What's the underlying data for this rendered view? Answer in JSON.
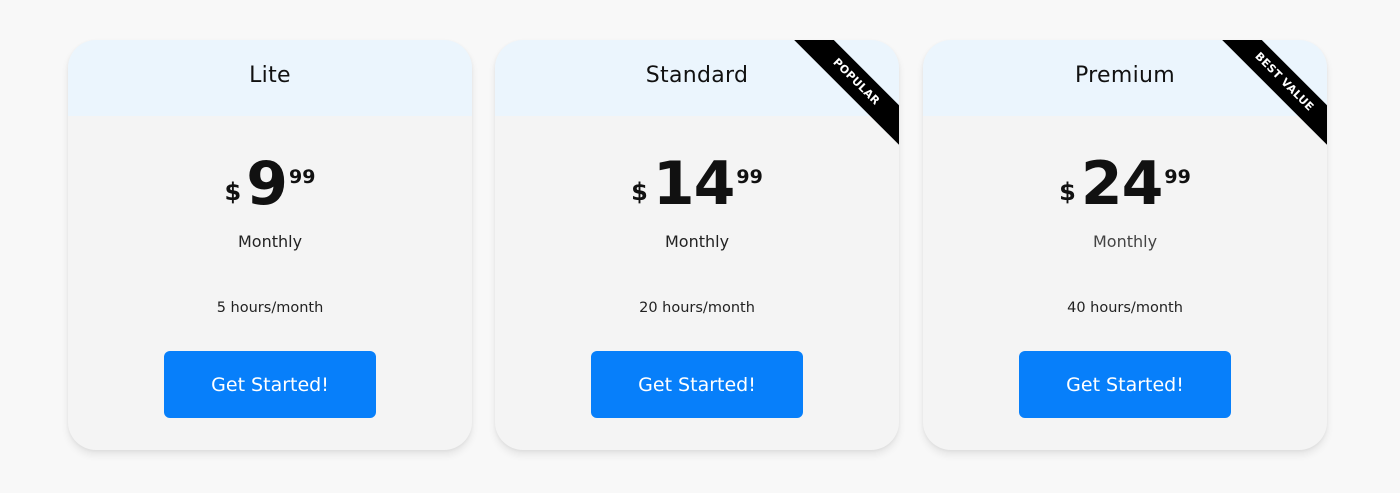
{
  "plans": [
    {
      "name": "Lite",
      "currency": "$",
      "amount": "9",
      "cents": "99",
      "period": "Monthly",
      "feature": "5 hours/month",
      "cta": "Get Started!",
      "badge": ""
    },
    {
      "name": "Standard",
      "currency": "$",
      "amount": "14",
      "cents": "99",
      "period": "Monthly",
      "feature": "20 hours/month",
      "cta": "Get Started!",
      "badge": "POPULAR"
    },
    {
      "name": "Premium",
      "currency": "$",
      "amount": "24",
      "cents": "99",
      "period": "Monthly",
      "feature": "40 hours/month",
      "cta": "Get Started!",
      "badge": "BEST VALUE"
    }
  ],
  "colors": {
    "page_background": "#f8f8f8",
    "card_background": "#f4f4f4",
    "header_background": "#ebf5fd",
    "button_background": "#077ffa",
    "ribbon_background": "#000000"
  }
}
